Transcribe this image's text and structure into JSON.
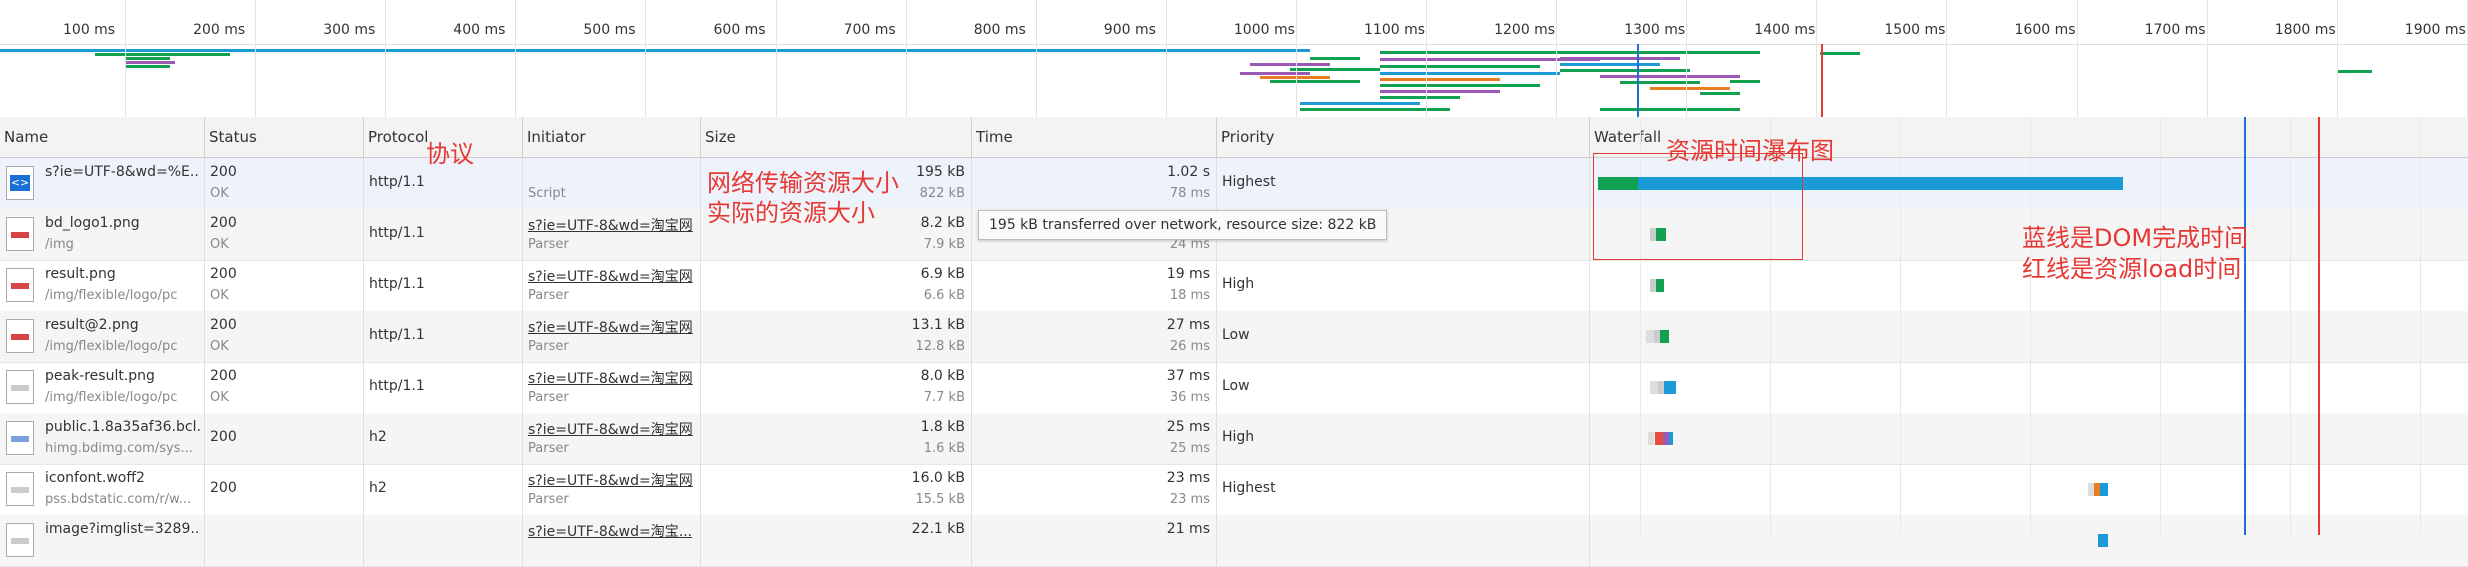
{
  "overview": {
    "ticks": [
      "100 ms",
      "200 ms",
      "300 ms",
      "400 ms",
      "500 ms",
      "600 ms",
      "700 ms",
      "800 ms",
      "900 ms",
      "1000 ms",
      "1100 ms",
      "1200 ms",
      "1300 ms",
      "1400 ms",
      "1500 ms",
      "1600 ms",
      "1700 ms",
      "1800 ms",
      "1900 ms"
    ]
  },
  "columns": {
    "name": "Name",
    "status": "Status",
    "protocol": "Protocol",
    "initiator": "Initiator",
    "size": "Size",
    "time": "Time",
    "priority": "Priority",
    "waterfall": "Waterfall"
  },
  "rows": [
    {
      "name": "s?ie=UTF-8&wd=%E...",
      "path": "",
      "status": "200",
      "status_text": "OK",
      "protocol": "http/1.1",
      "initiator": "",
      "initiator_type": "Script",
      "size": "195 kB",
      "resource": "822 kB",
      "time": "1.02 s",
      "latency": "78 ms",
      "priority": "Highest"
    },
    {
      "name": "bd_logo1.png",
      "path": "/img",
      "status": "200",
      "status_text": "OK",
      "protocol": "http/1.1",
      "initiator": "s?ie=UTF-8&wd=淘宝网",
      "initiator_type": "Parser",
      "size": "8.2 kB",
      "resource": "7.9 kB",
      "time": "",
      "latency": "24 ms",
      "priority": ""
    },
    {
      "name": "result.png",
      "path": "/img/flexible/logo/pc",
      "status": "200",
      "status_text": "OK",
      "protocol": "http/1.1",
      "initiator": "s?ie=UTF-8&wd=淘宝网",
      "initiator_type": "Parser",
      "size": "6.9 kB",
      "resource": "6.6 kB",
      "time": "19 ms",
      "latency": "18 ms",
      "priority": "High"
    },
    {
      "name": "result@2.png",
      "path": "/img/flexible/logo/pc",
      "status": "200",
      "status_text": "OK",
      "protocol": "http/1.1",
      "initiator": "s?ie=UTF-8&wd=淘宝网",
      "initiator_type": "Parser",
      "size": "13.1 kB",
      "resource": "12.8 kB",
      "time": "27 ms",
      "latency": "26 ms",
      "priority": "Low"
    },
    {
      "name": "peak-result.png",
      "path": "/img/flexible/logo/pc",
      "status": "200",
      "status_text": "OK",
      "protocol": "http/1.1",
      "initiator": "s?ie=UTF-8&wd=淘宝网",
      "initiator_type": "Parser",
      "size": "8.0 kB",
      "resource": "7.7 kB",
      "time": "37 ms",
      "latency": "36 ms",
      "priority": "Low"
    },
    {
      "name": "public.1.8a35af36.bcl...",
      "path": "himg.bdimg.com/sys...",
      "status": "200",
      "status_text": "",
      "protocol": "h2",
      "initiator": "s?ie=UTF-8&wd=淘宝网",
      "initiator_type": "Parser",
      "size": "1.8 kB",
      "resource": "1.6 kB",
      "time": "25 ms",
      "latency": "25 ms",
      "priority": "High"
    },
    {
      "name": "iconfont.woff2",
      "path": "pss.bdstatic.com/r/w...",
      "status": "200",
      "status_text": "",
      "protocol": "h2",
      "initiator": "s?ie=UTF-8&wd=淘宝网",
      "initiator_type": "Parser",
      "size": "16.0 kB",
      "resource": "15.5 kB",
      "time": "23 ms",
      "latency": "23 ms",
      "priority": "Highest"
    },
    {
      "name": "image?imglist=3289...",
      "path": "",
      "status": "",
      "status_text": "",
      "protocol": "",
      "initiator": "s?ie=UTF-8&wd=淘宝...",
      "initiator_type": "",
      "size": "22.1 kB",
      "resource": "",
      "time": "21 ms",
      "latency": "",
      "priority": ""
    }
  ],
  "tooltip": "195 kB transferred over network, resource size: 822 kB",
  "annotations": {
    "protocol": "协议",
    "size_line1": "网络传输资源大小",
    "size_line2": "实际的资源大小",
    "waterfall": "资源时间瀑布图",
    "blue_line": "蓝线是DOM完成时间",
    "red_line": "红线是资源load时间"
  },
  "colors": {
    "dom_line": "#1e6fd9",
    "load_line": "#e53935",
    "wait_green": "#12a150",
    "download_blue": "#1a9ad6",
    "annotation": "#e53935"
  }
}
